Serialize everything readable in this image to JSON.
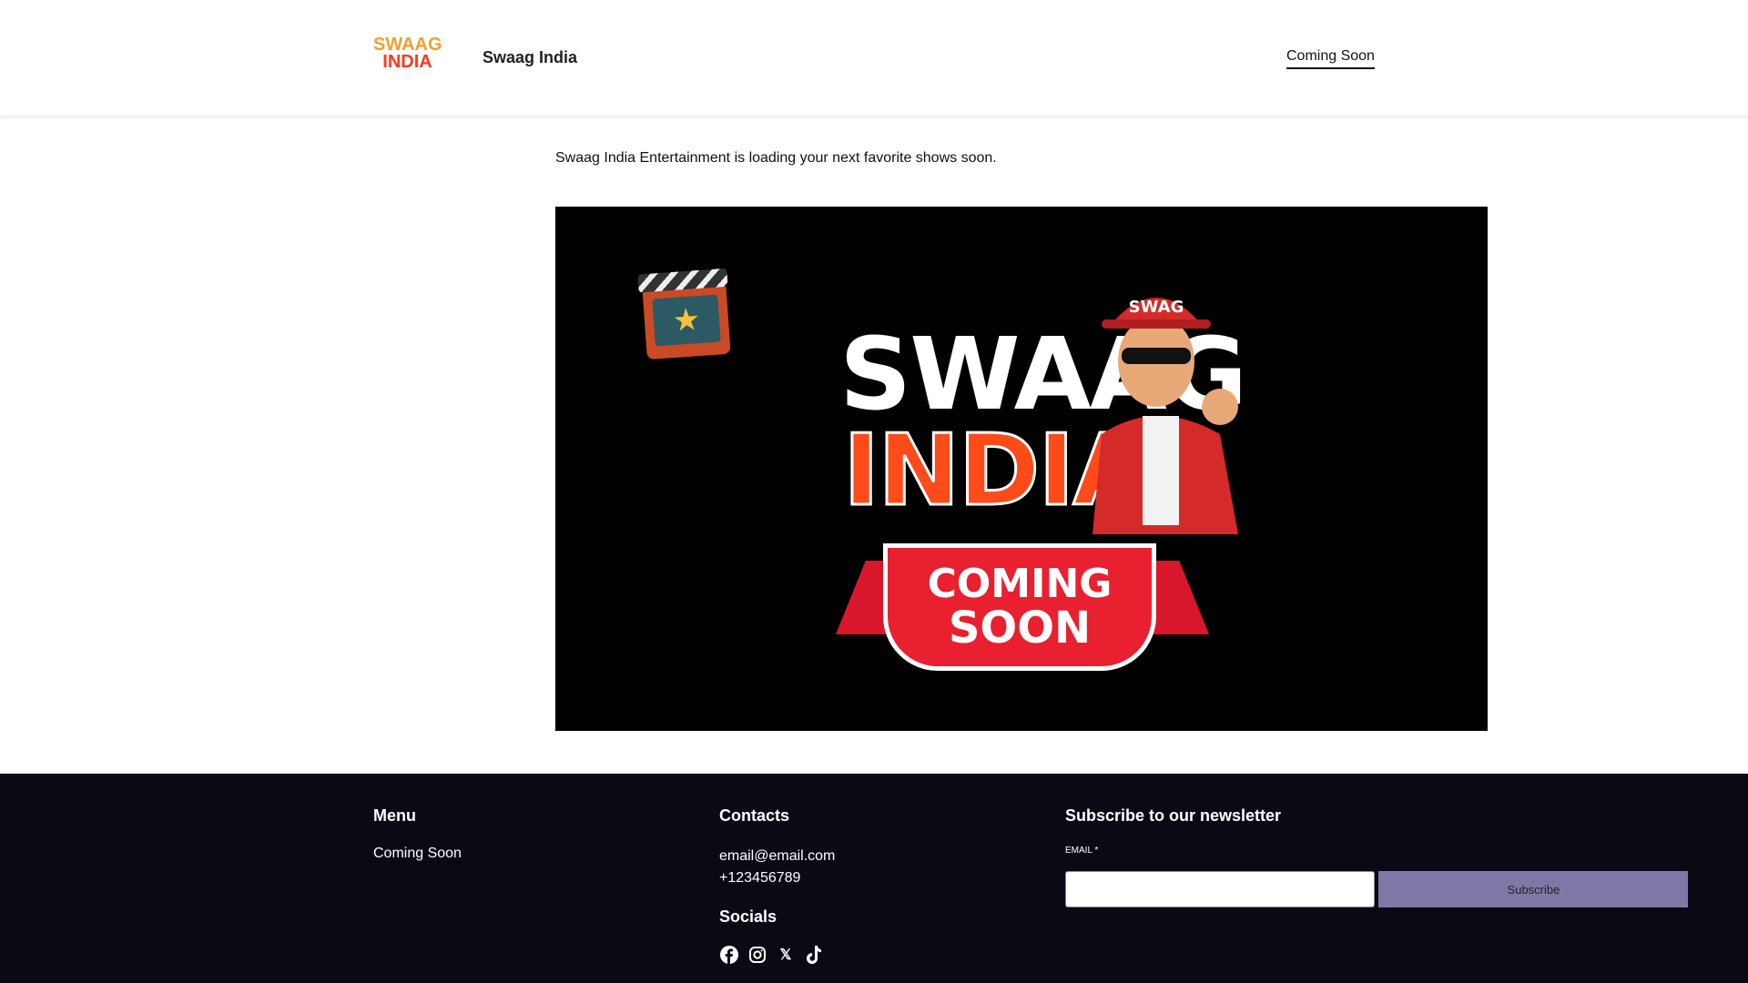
{
  "header": {
    "logo_text": [
      "SWAAG",
      "INDIA"
    ],
    "title": "Swaag India",
    "nav": [
      {
        "label": "Coming Soon"
      }
    ]
  },
  "main": {
    "tagline": "Swaag India Entertainment is loading your next favorite shows soon.",
    "hero": {
      "lettering": [
        "SWAAG",
        "INDIA",
        "SWAG",
        "COMING",
        "SOON"
      ]
    }
  },
  "footer": {
    "menu": {
      "heading": "Menu",
      "items": [
        {
          "label": "Coming Soon"
        }
      ]
    },
    "contacts": {
      "heading": "Contacts",
      "email": "email@email.com",
      "phone": "+123456789"
    },
    "socials": {
      "heading": "Socials",
      "icons": [
        "facebook-icon",
        "instagram-icon",
        "x-icon",
        "tiktok-icon"
      ]
    },
    "newsletter": {
      "heading": "Subscribe to our newsletter",
      "email_label": "EMAIL *",
      "email_value": "",
      "button": "Subscribe"
    }
  },
  "colors": {
    "button": "#7f78a6",
    "footer_bg": "#0b0a14",
    "accent": "#ff4a1a"
  }
}
